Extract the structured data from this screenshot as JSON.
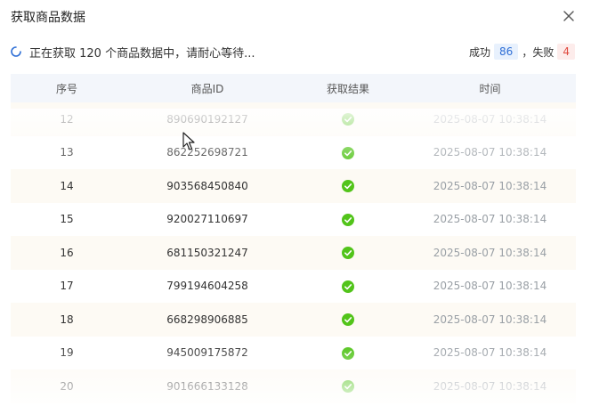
{
  "dialog": {
    "title": "获取商品数据",
    "close_icon": "close-icon"
  },
  "status": {
    "spinner_icon": "loading-spinner-icon",
    "message": "正在获取 120 个商品数据中，请耐心等待...",
    "success_label": "成功",
    "success_count": "86",
    "separator": "，",
    "fail_label": "失败",
    "fail_count": "4"
  },
  "table": {
    "headers": [
      "序号",
      "商品ID",
      "获取结果",
      "时间"
    ],
    "rows": [
      {
        "index": "12",
        "product_id": "890690192127",
        "result": "success",
        "time": "2025-08-07 10:38:14"
      },
      {
        "index": "13",
        "product_id": "862252698721",
        "result": "success",
        "time": "2025-08-07 10:38:14"
      },
      {
        "index": "14",
        "product_id": "903568450840",
        "result": "success",
        "time": "2025-08-07 10:38:14"
      },
      {
        "index": "15",
        "product_id": "920027110697",
        "result": "success",
        "time": "2025-08-07 10:38:14"
      },
      {
        "index": "16",
        "product_id": "681150321247",
        "result": "success",
        "time": "2025-08-07 10:38:14"
      },
      {
        "index": "17",
        "product_id": "799194604258",
        "result": "success",
        "time": "2025-08-07 10:38:14"
      },
      {
        "index": "18",
        "product_id": "668298906885",
        "result": "success",
        "time": "2025-08-07 10:38:14"
      },
      {
        "index": "19",
        "product_id": "945009175872",
        "result": "success",
        "time": "2025-08-07 10:38:14"
      },
      {
        "index": "20",
        "product_id": "901666133128",
        "result": "success",
        "time": "2025-08-07 10:38:14"
      }
    ]
  },
  "colors": {
    "accent": "#2f6fd6",
    "success_green": "#52c41a",
    "fail_red": "#e04a3f"
  }
}
